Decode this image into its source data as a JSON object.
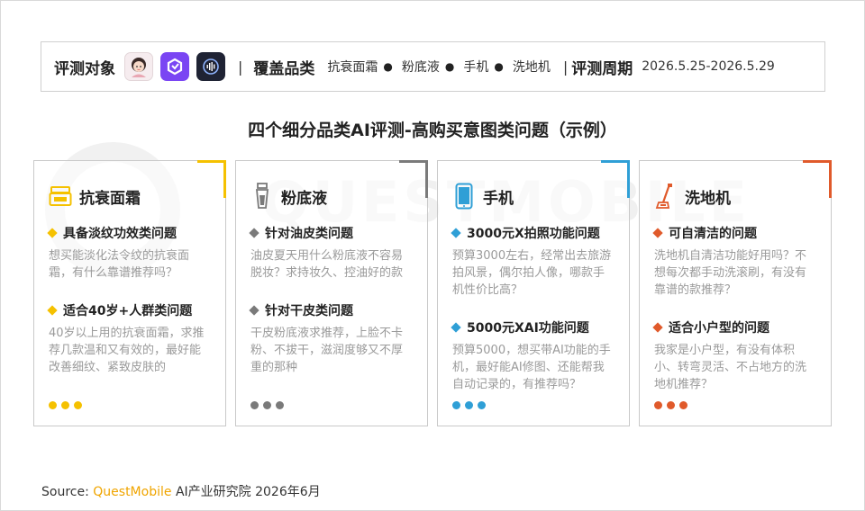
{
  "header": {
    "target_label": "评测对象",
    "separator": "|",
    "coverage_label": "覆盖品类",
    "categories": [
      "抗衰面霜",
      "粉底液",
      "手机",
      "洗地机"
    ],
    "period_label": "评测周期",
    "period_value": "2026.5.25-2026.5.29",
    "logos": [
      {
        "icon": "avatar-girl-icon",
        "color": "#f6ecef"
      },
      {
        "icon": "purple-app-icon",
        "color": "#7a45f3"
      },
      {
        "icon": "dark-app-icon",
        "color": "#1f2334"
      }
    ]
  },
  "title": "四个细分品类AI评测-高购买意图类问题（示例）",
  "cards": [
    {
      "name": "抗衰面霜",
      "icon": "cream-jar-icon",
      "accent": "#f5c100",
      "questions": [
        {
          "title": "具备淡纹功效类问题",
          "text": "想买能淡化法令纹的抗衰面霜，有什么靠谱推荐吗？"
        },
        {
          "title": "适合40岁+人群类问题",
          "text": "40岁以上用的抗衰面霜，求推荐几款温和又有效的，最好能改善细纹、紧致皮肤的"
        }
      ]
    },
    {
      "name": "粉底液",
      "icon": "foundation-bottle-icon",
      "accent": "#7a7a7a",
      "questions": [
        {
          "title": "针对油皮类问题",
          "text": "油皮夏天用什么粉底液不容易脱妆？求持妆久、控油好的款"
        },
        {
          "title": "针对干皮类问题",
          "text": "干皮粉底液求推荐，上脸不卡粉、不拔干，滋润度够又不厚重的那种"
        }
      ]
    },
    {
      "name": "手机",
      "icon": "phone-icon",
      "accent": "#2f9fd6",
      "questions": [
        {
          "title": "3000元X拍照功能问题",
          "text": "预算3000左右，经常出去旅游拍风景，偶尔拍人像，哪款手机性价比高？"
        },
        {
          "title": "5000元XAI功能问题",
          "text": "预算5000，想买带AI功能的手机，最好能AI修图、还能帮我自动记录的，有推荐吗？"
        }
      ]
    },
    {
      "name": "洗地机",
      "icon": "floor-washer-icon",
      "accent": "#e05a2b",
      "questions": [
        {
          "title": "可自清洁的问题",
          "text": "洗地机自清洁功能好用吗？不想每次都手动洗滚刷，有没有靠谱的款推荐？"
        },
        {
          "title": "适合小户型的问题",
          "text": "我家是小户型，有没有体积小、转弯灵活、不占地方的洗地机推荐？"
        }
      ]
    }
  ],
  "source": {
    "prefix": "Source: ",
    "brand": "QuestMobile",
    "suffix": " AI产业研究院 2026年6月"
  },
  "watermark": "QUESTMOBILE"
}
